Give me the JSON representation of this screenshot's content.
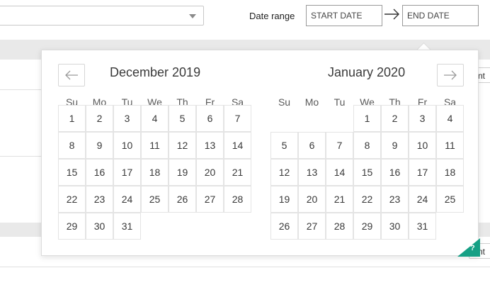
{
  "date_range": {
    "label": "Date range",
    "start_placeholder": "START DATE",
    "end_placeholder": "END DATE"
  },
  "background": {
    "side_button_text_1": "nt",
    "side_button_text_2": "nt"
  },
  "calendar": {
    "weekdays": [
      "Su",
      "Mo",
      "Tu",
      "We",
      "Th",
      "Fr",
      "Sa"
    ],
    "months": [
      {
        "title": "December 2019",
        "weeks": [
          [
            "1",
            "2",
            "3",
            "4",
            "5",
            "6",
            "7"
          ],
          [
            "8",
            "9",
            "10",
            "11",
            "12",
            "13",
            "14"
          ],
          [
            "15",
            "16",
            "17",
            "18",
            "19",
            "20",
            "21"
          ],
          [
            "22",
            "23",
            "24",
            "25",
            "26",
            "27",
            "28"
          ],
          [
            "29",
            "30",
            "31",
            "",
            "",
            "",
            ""
          ]
        ]
      },
      {
        "title": "January 2020",
        "weeks": [
          [
            "",
            "",
            "",
            "1",
            "2",
            "3",
            "4"
          ],
          [
            "5",
            "6",
            "7",
            "8",
            "9",
            "10",
            "11"
          ],
          [
            "12",
            "13",
            "14",
            "15",
            "16",
            "17",
            "18"
          ],
          [
            "19",
            "20",
            "21",
            "22",
            "23",
            "24",
            "25"
          ],
          [
            "26",
            "27",
            "28",
            "29",
            "30",
            "31",
            ""
          ]
        ]
      }
    ]
  },
  "help": {
    "symbol": "?"
  },
  "icons": {
    "prev": "arrow-left-icon",
    "next": "arrow-right-icon",
    "range_arrow": "arrow-right-icon",
    "dropdown": "chevron-down-icon"
  },
  "colors": {
    "help_badge": "#16a085"
  }
}
